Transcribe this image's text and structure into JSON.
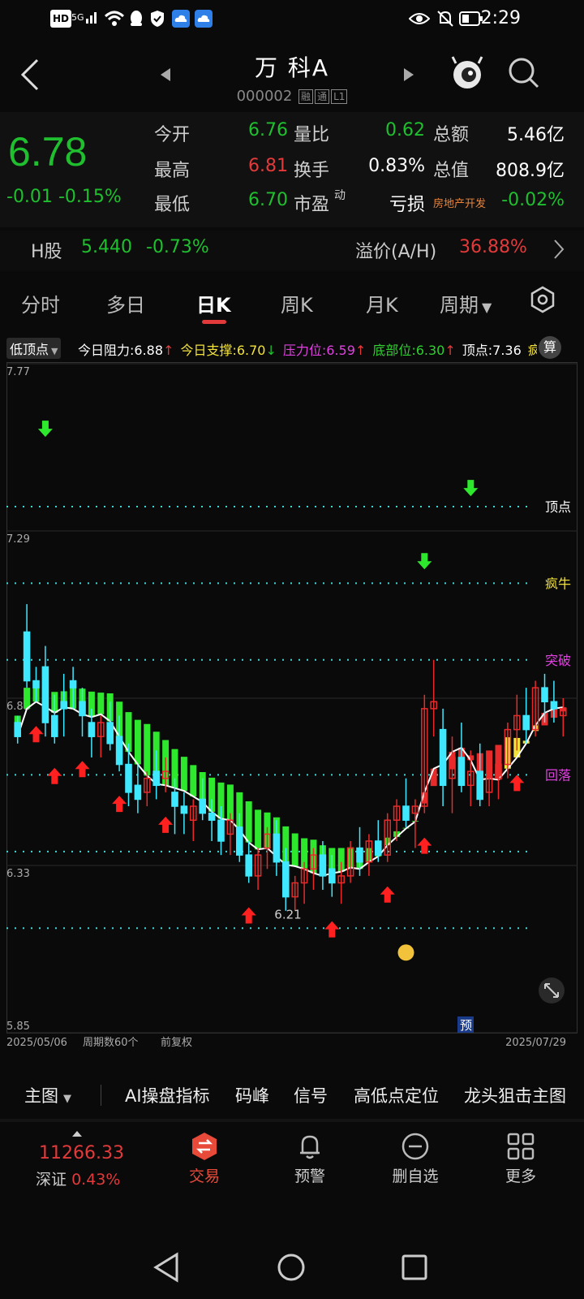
{
  "status_bar": {
    "time": "2:29",
    "left_icons": [
      "hd-icon",
      "5g-signal-icon",
      "wifi-icon",
      "qq-icon",
      "shield-icon",
      "cloud-icon",
      "cloud-icon"
    ],
    "hd": "HD",
    "net": "5G"
  },
  "header": {
    "title": "万 科A",
    "code": "000002",
    "tags": [
      "融",
      "通",
      "L1"
    ]
  },
  "quote": {
    "price": "6.78",
    "change": "-0.01",
    "change_pct": "-0.15%",
    "rows": [
      [
        {
          "label": "今开",
          "value": "6.76",
          "color": "green"
        },
        {
          "label": "量比",
          "value": "0.62",
          "color": "green"
        },
        {
          "label": "总额",
          "value": "5.46亿",
          "color": "white"
        }
      ],
      [
        {
          "label": "最高",
          "value": "6.81",
          "color": "red"
        },
        {
          "label": "换手",
          "value": "0.83%",
          "color": "white"
        },
        {
          "label": "总值",
          "value": "808.9亿",
          "color": "white"
        }
      ],
      [
        {
          "label": "最低",
          "value": "6.70",
          "color": "green"
        },
        {
          "label": "市盈",
          "sup": "动",
          "value": "亏损",
          "color": "white"
        },
        {
          "label": "房地产开发",
          "value": "-0.02%",
          "color": "green"
        }
      ]
    ]
  },
  "h_share": {
    "label": "H股",
    "price": "5.440",
    "pct": "-0.73%",
    "premium_label": "溢价(A/H)",
    "premium": "36.88%"
  },
  "tabs": [
    "分时",
    "多日",
    "日K",
    "周K",
    "月K",
    "周期"
  ],
  "active_tab": "日K",
  "indicator_bar": {
    "selector": "低顶点",
    "items": [
      {
        "text": "今日阻力:6.88",
        "arrow": "↑",
        "color": "#ffffff",
        "arrow_color": "#e23a3a"
      },
      {
        "text": "今日支撑:6.70",
        "arrow": "↓",
        "color": "#f2e23a",
        "arrow_color": "#1fbf2f"
      },
      {
        "text": "压力位:6.59",
        "arrow": "↑",
        "color": "#e040e0",
        "arrow_color": "#e23a3a"
      },
      {
        "text": "底部位:6.30",
        "arrow": "↑",
        "color": "#2fd02f",
        "arrow_color": "#e23a3a"
      },
      {
        "text": "顶点:7.36",
        "arrow": "",
        "color": "#ffffff",
        "arrow_color": "#ffffff"
      },
      {
        "text": "疯",
        "arrow": "",
        "color": "#f2e23a",
        "arrow_color": "#f2e23a"
      }
    ],
    "calc_btn": "算"
  },
  "chart_data": {
    "type": "candlestick",
    "y_labels": [
      "7.77",
      "7.29",
      "6.81",
      "6.33",
      "5.85"
    ],
    "ylim": [
      5.85,
      7.77
    ],
    "start_date": "2025/05/06",
    "end_date": "2025/07/29",
    "period_count": "周期数60个",
    "adjust": "前复权",
    "min_label": "6.21",
    "levels": [
      {
        "name": "顶点",
        "value": 7.36,
        "color": "#ffffff"
      },
      {
        "name": "疯牛",
        "value": 7.14,
        "color": "#f2e23a"
      },
      {
        "name": "突破",
        "value": 6.92,
        "color": "#e040e0"
      },
      {
        "name": "回落",
        "value": 6.59,
        "color": "#e040e0"
      },
      {
        "name": "",
        "value": 6.37,
        "color": ""
      },
      {
        "name": "",
        "value": 6.15,
        "color": ""
      }
    ],
    "forecast_label": "预",
    "series": [
      {
        "name": "candles",
        "ohlc": [
          [
            6.74,
            6.76,
            6.68,
            6.7
          ],
          [
            7.0,
            7.08,
            6.84,
            6.86
          ],
          [
            6.86,
            6.9,
            6.8,
            6.84
          ],
          [
            6.9,
            6.96,
            6.7,
            6.74
          ],
          [
            6.76,
            6.82,
            6.68,
            6.7
          ],
          [
            6.8,
            6.88,
            6.7,
            6.78
          ],
          [
            6.86,
            6.9,
            6.78,
            6.84
          ],
          [
            6.8,
            6.84,
            6.7,
            6.76
          ],
          [
            6.74,
            6.78,
            6.64,
            6.7
          ],
          [
            6.7,
            6.76,
            6.64,
            6.74
          ],
          [
            6.74,
            6.8,
            6.66,
            6.68
          ],
          [
            6.7,
            6.76,
            6.6,
            6.62
          ],
          [
            6.62,
            6.68,
            6.5,
            6.54
          ],
          [
            6.56,
            6.62,
            6.48,
            6.52
          ],
          [
            6.54,
            6.6,
            6.5,
            6.58
          ],
          [
            6.6,
            6.66,
            6.52,
            6.56
          ],
          [
            6.58,
            6.64,
            6.54,
            6.6
          ],
          [
            6.54,
            6.58,
            6.42,
            6.5
          ],
          [
            6.5,
            6.54,
            6.42,
            6.48
          ],
          [
            6.46,
            6.52,
            6.4,
            6.5
          ],
          [
            6.52,
            6.58,
            6.46,
            6.48
          ],
          [
            6.48,
            6.52,
            6.4,
            6.46
          ],
          [
            6.46,
            6.5,
            6.36,
            6.4
          ],
          [
            6.42,
            6.48,
            6.36,
            6.46
          ],
          [
            6.44,
            6.48,
            6.34,
            6.36
          ],
          [
            6.36,
            6.4,
            6.28,
            6.3
          ],
          [
            6.3,
            6.38,
            6.26,
            6.36
          ],
          [
            6.38,
            6.44,
            6.32,
            6.42
          ],
          [
            6.42,
            6.46,
            6.3,
            6.34
          ],
          [
            6.34,
            6.38,
            6.2,
            6.24
          ],
          [
            6.24,
            6.3,
            6.2,
            6.28
          ],
          [
            6.28,
            6.34,
            6.22,
            6.32
          ],
          [
            6.32,
            6.38,
            6.26,
            6.36
          ],
          [
            6.36,
            6.4,
            6.26,
            6.3
          ],
          [
            6.32,
            6.36,
            6.24,
            6.28
          ],
          [
            6.28,
            6.34,
            6.22,
            6.3
          ],
          [
            6.3,
            6.4,
            6.28,
            6.38
          ],
          [
            6.38,
            6.44,
            6.3,
            6.34
          ],
          [
            6.34,
            6.42,
            6.3,
            6.4
          ],
          [
            6.4,
            6.46,
            6.34,
            6.36
          ],
          [
            6.36,
            6.48,
            6.34,
            6.46
          ],
          [
            6.46,
            6.52,
            6.4,
            6.5
          ],
          [
            6.5,
            6.58,
            6.44,
            6.46
          ],
          [
            6.48,
            6.52,
            6.38,
            6.5
          ],
          [
            6.5,
            6.82,
            6.48,
            6.78
          ],
          [
            6.78,
            6.92,
            6.7,
            6.8
          ],
          [
            6.72,
            6.78,
            6.5,
            6.56
          ],
          [
            6.58,
            6.7,
            6.48,
            6.64
          ],
          [
            6.64,
            6.74,
            6.54,
            6.56
          ],
          [
            6.56,
            6.66,
            6.5,
            6.6
          ],
          [
            6.6,
            6.68,
            6.5,
            6.52
          ],
          [
            6.54,
            6.62,
            6.5,
            6.58
          ],
          [
            6.58,
            6.66,
            6.52,
            6.62
          ],
          [
            6.62,
            6.74,
            6.58,
            6.72
          ],
          [
            6.72,
            6.82,
            6.66,
            6.76
          ],
          [
            6.76,
            6.84,
            6.68,
            6.72
          ],
          [
            6.72,
            6.86,
            6.7,
            6.84
          ],
          [
            6.84,
            6.88,
            6.74,
            6.8
          ],
          [
            6.8,
            6.86,
            6.74,
            6.78
          ],
          [
            6.76,
            6.81,
            6.7,
            6.78
          ]
        ]
      }
    ]
  },
  "toolbar": {
    "main": "主图",
    "items": [
      "AI操盘指标",
      "码峰",
      "信号",
      "高低点定位",
      "龙头狙击主图"
    ]
  },
  "bottom_nav": {
    "index_value": "11266.33",
    "index_name": "深证",
    "index_pct": "0.43%",
    "items": [
      {
        "label": "交易",
        "icon": "trade-icon"
      },
      {
        "label": "预警",
        "icon": "bell-icon"
      },
      {
        "label": "删自选",
        "icon": "remove-icon"
      },
      {
        "label": "更多",
        "icon": "grid-icon"
      }
    ]
  },
  "colors": {
    "up": "#e23a3a",
    "down": "#1fbf2f",
    "cyan": "#3fe8ff",
    "bg": "#0a0a0a"
  }
}
